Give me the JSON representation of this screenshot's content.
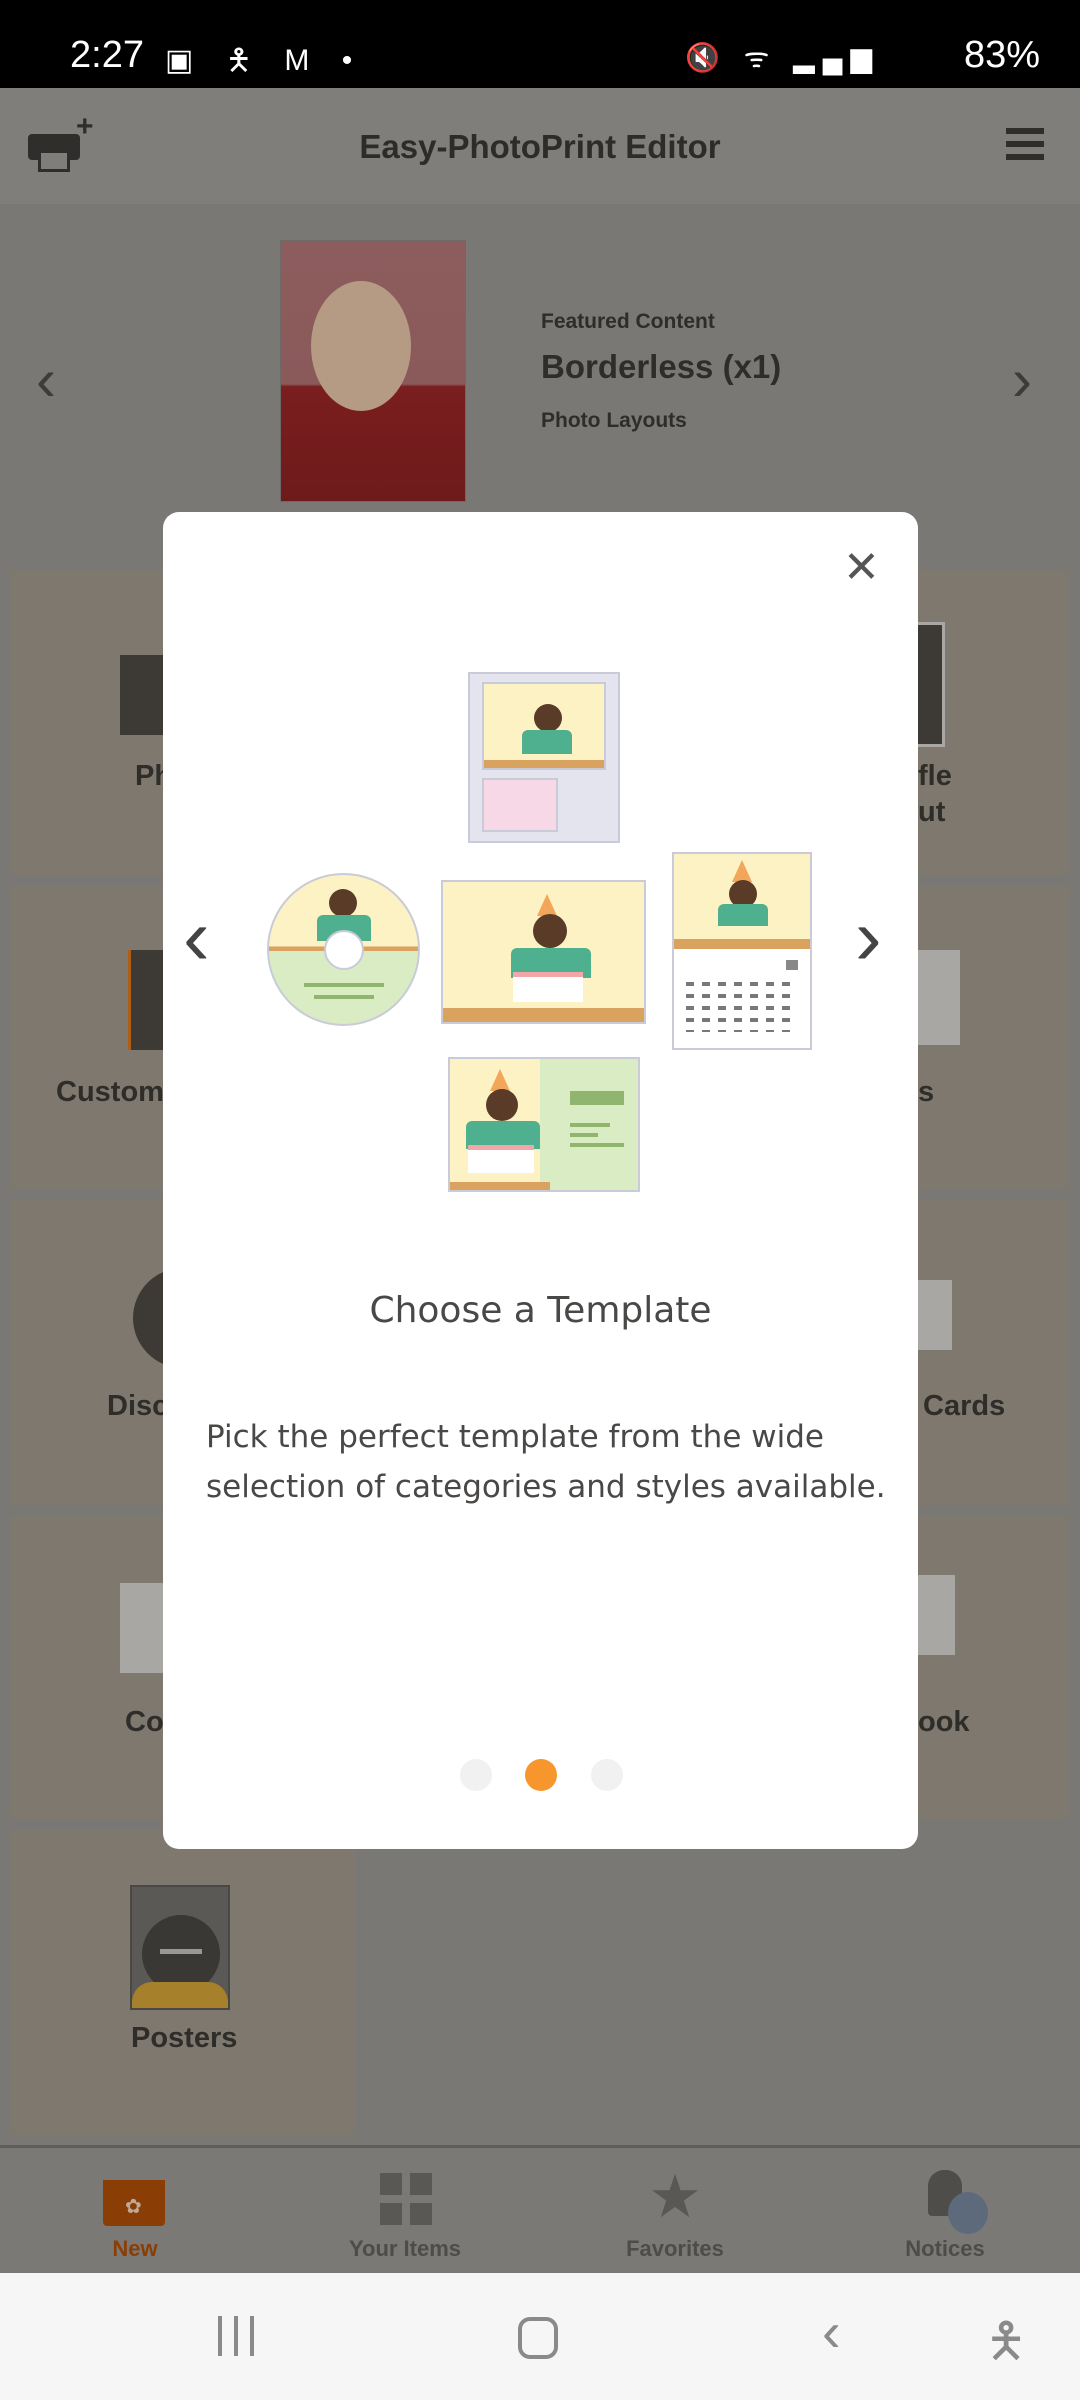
{
  "status_bar": {
    "time": "2:27",
    "battery": "83%",
    "icons": [
      "image-icon",
      "accessibility-icon",
      "gmail-icon",
      "dot-icon",
      "mute-icon",
      "wifi-icon",
      "signal-icon",
      "battery-icon"
    ]
  },
  "header": {
    "title": "Easy-PhotoPrint Editor",
    "left_icon": "printer-add-icon",
    "right_icon": "menu-icon"
  },
  "featured": {
    "kicker": "Featured Content",
    "title": "Borderless (x1)",
    "category": "Photo Layouts"
  },
  "grid": {
    "left_labels": [
      "Ph",
      "Custom",
      "Disc",
      "Co",
      "Posters"
    ],
    "right_labels": [
      "fle",
      "ut",
      "s",
      "Cards",
      "ook"
    ]
  },
  "modal": {
    "title": "Choose a Template",
    "description": "Pick the perfect template from the wide selection of categories and styles available.",
    "page_index": 2,
    "page_count": 3,
    "accent": "#f7962c"
  },
  "bottom_nav": {
    "items": [
      {
        "label": "New",
        "active": true
      },
      {
        "label": "Your Items"
      },
      {
        "label": "Favorites"
      },
      {
        "label": "Notices"
      }
    ],
    "active_color": "#8a3e06"
  }
}
